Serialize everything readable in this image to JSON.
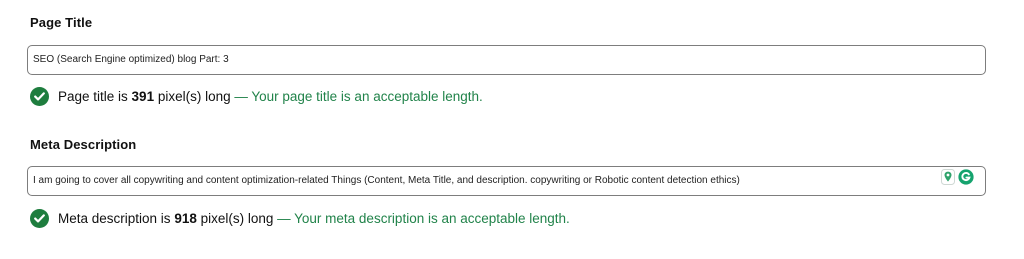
{
  "page_title": {
    "label": "Page Title",
    "value": "SEO (Search Engine optimized) blog Part: 3",
    "status": {
      "prefix": "Page title is ",
      "pixels": "391",
      "suffix": " pixel(s) long",
      "message": " — Your page title is an acceptable length."
    }
  },
  "meta_description": {
    "label": "Meta Description",
    "value": "I am going to cover all copywriting and content optimization-related Things (Content, Meta Title, and description.  copywriting or Robotic content detection ethics)",
    "status": {
      "prefix": "Meta description is ",
      "pixels": "918",
      "suffix": " pixel(s) long",
      "message": " — Your meta description is an acceptable length."
    }
  },
  "icons": {
    "check": "check-circle-icon",
    "pin": "map-pin-icon",
    "grammarly": "grammarly-icon"
  },
  "colors": {
    "success": "#1e7d3e",
    "success_text": "#21834a",
    "border": "#7d7d7d"
  }
}
